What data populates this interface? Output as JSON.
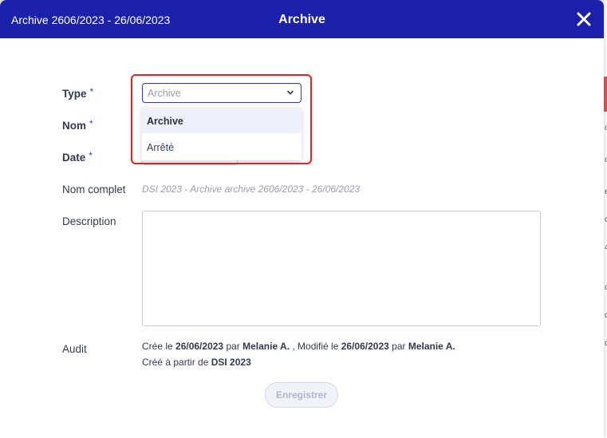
{
  "header": {
    "subtitle": "Archive 2606/2023 - 26/06/2023",
    "title": "Archive",
    "close_icon": "close-icon"
  },
  "form": {
    "type": {
      "label": "Type",
      "required_mark": "*",
      "selected": "Archive",
      "options": [
        "Archive",
        "Arrêté"
      ]
    },
    "nom": {
      "label": "Nom",
      "required_mark": "*"
    },
    "date": {
      "label": "Date",
      "required_mark": "*"
    },
    "nom_complet": {
      "label": "Nom complet",
      "value": "DSI 2023 - Archive archive 2606/2023 - 26/06/2023"
    },
    "description": {
      "label": "Description",
      "value": ""
    },
    "audit": {
      "label": "Audit",
      "line1_created_prefix": "Crée le",
      "created_date": "26/06/2023",
      "line1_par": "par",
      "created_by": "Melanie A.",
      "line1_modified_prefix": ", Modifié le",
      "modified_date": "26/06/2023",
      "line1_par2": "par",
      "modified_by": "Melanie A.",
      "line2_prefix": "Créé à partir de",
      "source": "DSI 2023"
    }
  },
  "actions": {
    "save_label": "Enregistrer"
  },
  "colors": {
    "header_bg": "#1b21a8",
    "highlight_border": "#e8201e",
    "required_mark": "#3340d0"
  }
}
